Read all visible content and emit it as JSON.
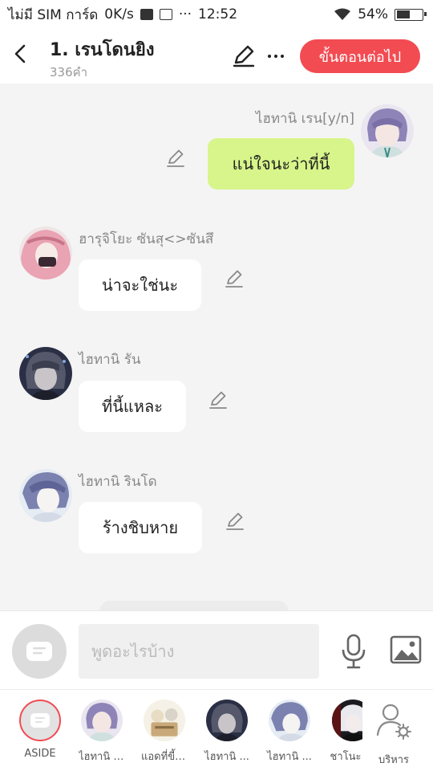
{
  "status_bar": {
    "carrier": "ไม่มี SIM การ์ด",
    "speed": "0K/s",
    "more": "···",
    "time": "12:52",
    "battery": "54%",
    "battery_level": 0.54
  },
  "header": {
    "title": "1. เรนโดนยิง",
    "word_count": "336คำ",
    "next_button": "ขั้นตอนต่อไป"
  },
  "messages": [
    {
      "sender": "ไฮทานิ  เรน[y/n]",
      "text": "แน่ใจนะว่าที่นี้",
      "side": "right"
    },
    {
      "sender": "ฮารุจิโยะ  ซันสุ<>ซันสึ",
      "text": "น่าจะใช่นะ",
      "side": "left"
    },
    {
      "sender": "ไฮทานิ  รัน",
      "text": "ที่นี้แหละ",
      "side": "left"
    },
    {
      "sender": "ไฮทานิ  รินโด",
      "text": "ร้างชิบหาย",
      "side": "left"
    }
  ],
  "input": {
    "placeholder": "พูดอะไรบ้าง"
  },
  "character_bar": [
    {
      "label": "ASIDE"
    },
    {
      "label": "ไฮทานิ เ..."
    },
    {
      "label": "แอดที่ขี้เ..."
    },
    {
      "label": "ไฮทานิ ..."
    },
    {
      "label": "ไฮทานิ ..."
    },
    {
      "label": "ชาโนะ"
    },
    {
      "label": "บริหาร"
    }
  ],
  "colors": {
    "accent": "#f24b52",
    "my_bubble": "#d7f58a",
    "other_bubble": "#ffffff",
    "chat_bg": "#f4f4f4"
  }
}
